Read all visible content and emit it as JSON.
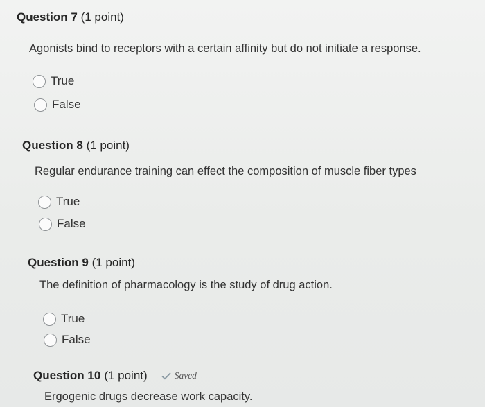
{
  "questions": [
    {
      "number": "Question 7",
      "points": "(1 point)",
      "text": "Agonists bind to receptors with a certain affinity but do not initiate a response.",
      "options": [
        "True",
        "False"
      ]
    },
    {
      "number": "Question 8",
      "points": "(1 point)",
      "text": "Regular endurance training can effect the composition of muscle fiber types",
      "options": [
        "True",
        "False"
      ]
    },
    {
      "number": "Question 9",
      "points": "(1 point)",
      "text": "The definition of pharmacology is the study of drug action.",
      "options": [
        "True",
        "False"
      ]
    },
    {
      "number": "Question 10",
      "points": "(1 point)",
      "status": "Saved",
      "text": "Ergogenic drugs decrease work capacity."
    }
  ],
  "colors": {
    "saved_check": "#8a9aa3",
    "radio_border": "#8f9396"
  },
  "icons": {
    "saved": "checkmark-icon",
    "radio": "radio-button-unselected"
  }
}
